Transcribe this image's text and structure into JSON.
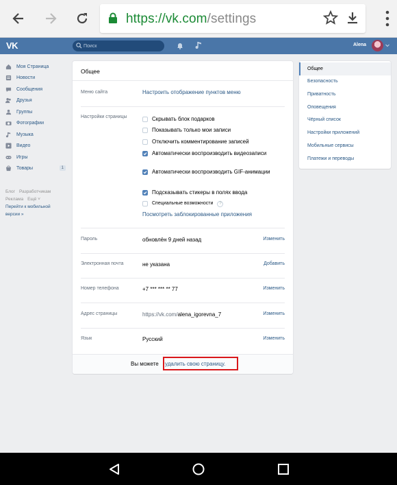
{
  "browser": {
    "url_scheme": "https://",
    "url_host": "vk.com",
    "url_path": "/settings"
  },
  "header": {
    "logo": "VK",
    "search_placeholder": "Поиск",
    "user_name": "Alena"
  },
  "left_menu": {
    "items": [
      {
        "label": "Моя Страница",
        "icon": "home-icon"
      },
      {
        "label": "Новости",
        "icon": "news-icon"
      },
      {
        "label": "Сообщения",
        "icon": "messages-icon"
      },
      {
        "label": "Друзья",
        "icon": "friends-icon"
      },
      {
        "label": "Группы",
        "icon": "groups-icon"
      },
      {
        "label": "Фотографии",
        "icon": "camera-icon"
      },
      {
        "label": "Музыка",
        "icon": "music-icon"
      },
      {
        "label": "Видео",
        "icon": "video-icon"
      },
      {
        "label": "Игры",
        "icon": "games-icon"
      },
      {
        "label": "Товары",
        "icon": "market-icon",
        "badge": "1"
      }
    ],
    "footer_links": [
      "Блог",
      "Разработчикам",
      "Реклама",
      "Ещё ˅"
    ],
    "mobile_link": "Перейти к мобильной версии »"
  },
  "settings": {
    "title": "Общее",
    "site_menu_label": "Меню сайта",
    "site_menu_link": "Настроить отображение пунктов меню",
    "page_settings_label": "Настройки страницы",
    "checkboxes": [
      {
        "label": "Скрывать блок подарков",
        "checked": false
      },
      {
        "label": "Показывать только мои записи",
        "checked": false
      },
      {
        "label": "Отключить комментирование записей",
        "checked": false
      },
      {
        "label": "Автоматически воспроизводить видеозаписи",
        "checked": true
      },
      {
        "label": "Автоматически воспроизводить GIF-анимации",
        "checked": true
      },
      {
        "label": "Подсказывать стикеры в полях ввода",
        "checked": true
      },
      {
        "label": "Специальные возможности",
        "checked": false
      }
    ],
    "help_mark": "?",
    "blocked_apps_link": "Посмотреть заблокированные приложения",
    "password_label": "Пароль",
    "password_value": "обновлён 9 дней назад",
    "password_action": "Изменить",
    "email_label": "Электронная почта",
    "email_value": "не указана",
    "email_action": "Добавить",
    "phone_label": "Номер телефона",
    "phone_value": "+7 *** *** ** 77",
    "phone_action": "Изменить",
    "address_label": "Адрес страницы",
    "address_prefix": "https://vk.com/",
    "address_value": "alena_igorevna_7",
    "address_action": "Изменить",
    "language_label": "Язык",
    "language_value": "Русский",
    "language_action": "Изменить",
    "delete_text": "Вы можете",
    "delete_link": "удалить свою страницу."
  },
  "right_menu": {
    "items": [
      "Общее",
      "Безопасность",
      "Приватность",
      "Оповещения",
      "Чёрный список",
      "Настройки приложений",
      "Мобильные сервисы",
      "Платежи и переводы"
    ],
    "active_index": 0
  },
  "colors": {
    "vk_blue": "#4a76a8",
    "link": "#2a5885",
    "highlight_red": "#d9171b",
    "secure_green": "#1b8a35"
  }
}
